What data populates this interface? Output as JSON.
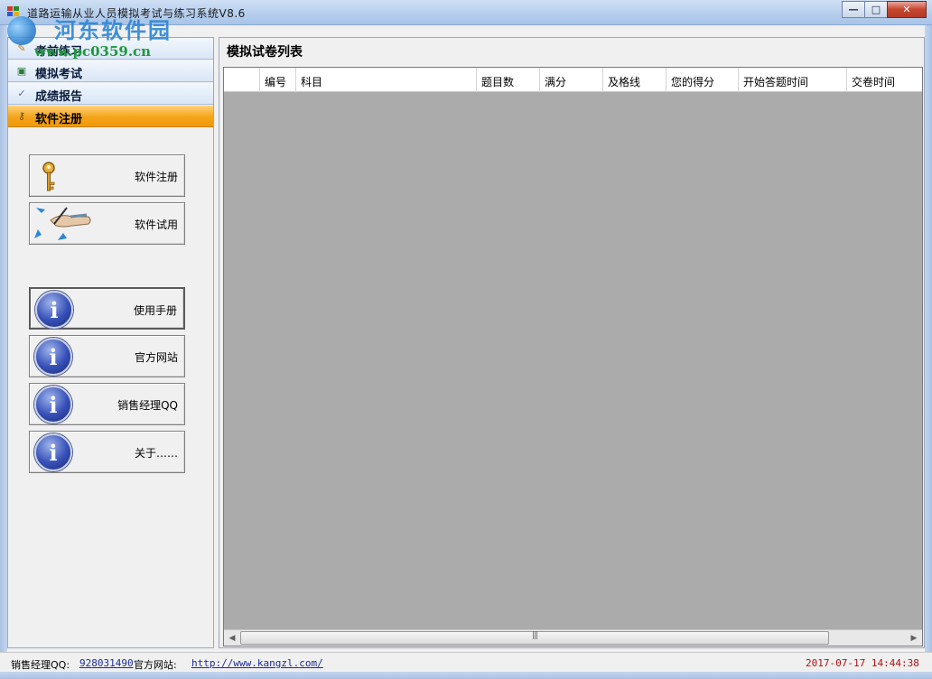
{
  "window": {
    "title": "道路运输从业人员模拟考试与练习系统V8.6",
    "controls": {
      "minimize": "—",
      "maximize": "□",
      "close": "✕"
    }
  },
  "watermark": {
    "main": "河东软件园",
    "url": "www.pc0359.cn"
  },
  "sidebar": {
    "nav": [
      {
        "label": "考前练习",
        "icon": "practice-icon",
        "active": false
      },
      {
        "label": "模拟考试",
        "icon": "exam-icon",
        "active": false
      },
      {
        "label": "成绩报告",
        "icon": "report-icon",
        "active": false
      },
      {
        "label": "软件注册",
        "icon": "key-icon",
        "active": true
      }
    ],
    "buttons": [
      {
        "label": "软件注册",
        "icon": "key-icon"
      },
      {
        "label": "软件试用",
        "icon": "trial-hand-icon"
      },
      {
        "label": "使用手册",
        "icon": "info-icon"
      },
      {
        "label": "官方网站",
        "icon": "info-icon"
      },
      {
        "label": "销售经理QQ",
        "icon": "info-icon"
      },
      {
        "label": "关于……",
        "icon": "info-icon"
      }
    ]
  },
  "main": {
    "title": "模拟试卷列表",
    "columns": [
      "编号",
      "科目",
      "题目数",
      "满分",
      "及格线",
      "您的得分",
      "开始答题时间",
      "交卷时间"
    ]
  },
  "statusbar": {
    "qq_label": "销售经理QQ:",
    "qq_value": "928031490",
    "site_label": "官方网站:",
    "site_value": "http://www.kangzl.com/",
    "datetime": "2017-07-17 14:44:38"
  }
}
